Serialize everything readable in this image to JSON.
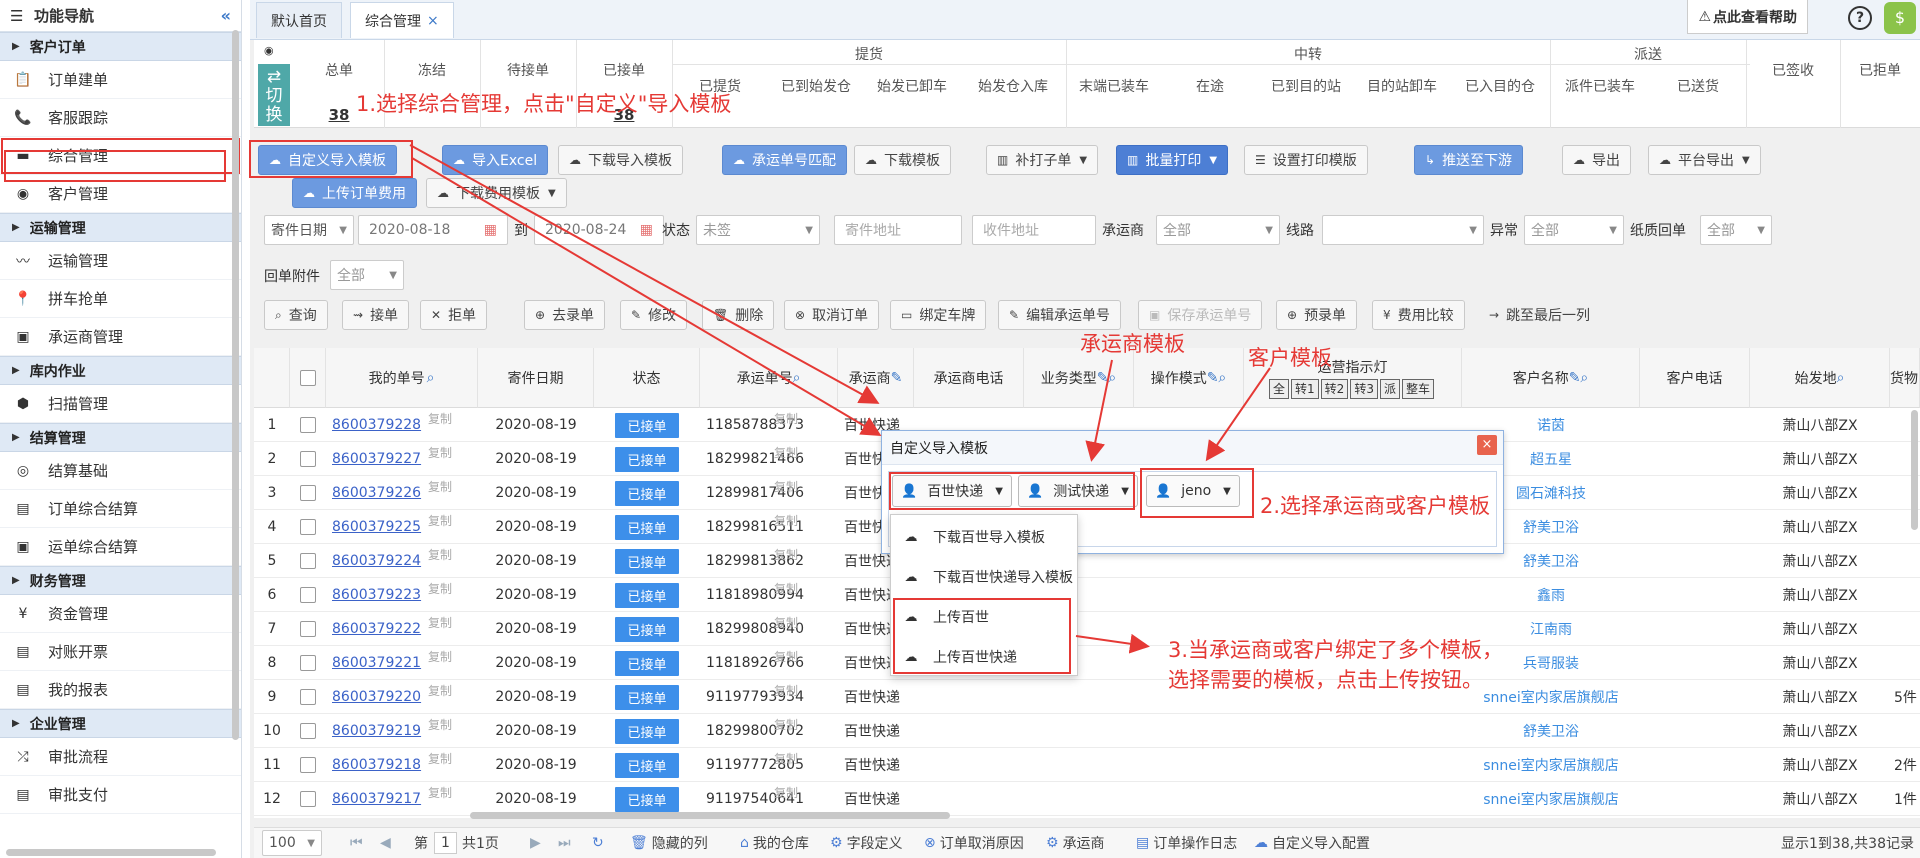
{
  "sidebar": {
    "title": "功能导航",
    "sections": [
      {
        "label": "客户订单",
        "items": [
          "订单建单",
          "客服跟踪",
          "综合管理",
          "客户管理"
        ]
      },
      {
        "label": "运输管理",
        "items": [
          "运输管理",
          "拼车抢单",
          "承运商管理"
        ]
      },
      {
        "label": "库内作业",
        "items": [
          "扫描管理"
        ]
      },
      {
        "label": "结算管理",
        "items": [
          "结算基础",
          "订单综合结算",
          "运单综合结算"
        ]
      },
      {
        "label": "财务管理",
        "items": [
          "资金管理",
          "对账开票",
          "我的报表"
        ]
      },
      {
        "label": "企业管理",
        "items": [
          "审批流程",
          "审批支付"
        ]
      }
    ]
  },
  "tabs": [
    {
      "label": "默认首页"
    },
    {
      "label": "综合管理",
      "close": "×"
    }
  ],
  "help": "点此查看帮助",
  "summary": {
    "switch": "切换",
    "headers": [
      "总单",
      "冻结",
      "待接单",
      "已接单"
    ],
    "group_tihuo": "提货",
    "group_zhongzhuan": "中转",
    "group_paisong": "派送",
    "sub": [
      "已提货",
      "已到始发仓",
      "始发已卸车",
      "始发仓入库",
      "末端已装车",
      "在途",
      "已到目的站",
      "目的站卸车",
      "已入目的仓",
      "派件已装车",
      "已送货"
    ],
    "signed": "已签收",
    "rejected": "已拒单",
    "total_value": "38",
    "accepted_value": "38"
  },
  "toolbar1": [
    "自定义导入模板",
    "导入Excel",
    "下载导入模板",
    "承运单号匹配",
    "下载模板",
    "补打子单",
    "批量打印",
    "设置打印模版",
    "推送至下游",
    "导出",
    "平台导出"
  ],
  "toolbar2": [
    "上传订单费用",
    "下载费用模板"
  ],
  "filters": {
    "date_type": "寄件日期",
    "date_from": "2020-08-18",
    "to": "到",
    "date_to": "2020-08-24",
    "status_label": "状态",
    "status_value": "未签",
    "sender_addr": "寄件地址",
    "recv_addr": "收件地址",
    "carrier_label": "承运商",
    "carrier_value": "全部",
    "route_label": "线路",
    "route_value": "",
    "abnormal_label": "异常",
    "abnormal_value": "全部",
    "paper_label": "纸质回单",
    "paper_value": "全部",
    "attach_label": "回单附件",
    "attach_value": "全部"
  },
  "actions": [
    "查询",
    "接单",
    "拒单",
    "去录单",
    "修改",
    "删除",
    "取消订单",
    "绑定车牌",
    "编辑承运单号",
    "保存承运单号",
    "预录单",
    "费用比较",
    "跳至最后一列"
  ],
  "grid": {
    "headers": [
      "我的单号",
      "寄件日期",
      "状态",
      "承运单号",
      "承运商",
      "承运商电话",
      "业务类型",
      "操作模式",
      "运营指示灯",
      "客户名称",
      "客户电话",
      "始发地",
      "货物"
    ],
    "lights": [
      "全",
      "转1",
      "转2",
      "转3",
      "派",
      "整车"
    ],
    "copy": "复制",
    "rows": [
      [
        "1",
        "8600379228",
        "2020-08-19",
        "已接单",
        "11858788373",
        "百世快递",
        "诺茵",
        "萧山八部ZX",
        ""
      ],
      [
        "2",
        "8600379227",
        "2020-08-19",
        "已接单",
        "18299821466",
        "百世快递",
        "超五星",
        "萧山八部ZX",
        ""
      ],
      [
        "3",
        "8600379226",
        "2020-08-19",
        "已接单",
        "12899817406",
        "百世快递",
        "圆石滩科技",
        "萧山八部ZX",
        ""
      ],
      [
        "4",
        "8600379225",
        "2020-08-19",
        "已接单",
        "18299816511",
        "百世快递",
        "舒美卫浴",
        "萧山八部ZX",
        ""
      ],
      [
        "5",
        "8600379224",
        "2020-08-19",
        "已接单",
        "18299813862",
        "百世快递",
        "舒美卫浴",
        "萧山八部ZX",
        ""
      ],
      [
        "6",
        "8600379223",
        "2020-08-19",
        "已接单",
        "11818980994",
        "百世快递",
        "鑫雨",
        "萧山八部ZX",
        ""
      ],
      [
        "7",
        "8600379222",
        "2020-08-19",
        "已接单",
        "18299808940",
        "百世快递",
        "江南雨",
        "萧山八部ZX",
        ""
      ],
      [
        "8",
        "8600379221",
        "2020-08-19",
        "已接单",
        "11818926766",
        "百世快递",
        "兵哥服装",
        "萧山八部ZX",
        ""
      ],
      [
        "9",
        "8600379220",
        "2020-08-19",
        "已接单",
        "91197793934",
        "百世快递",
        "snnei室内家居旗舰店",
        "萧山八部ZX",
        "5件"
      ],
      [
        "10",
        "8600379219",
        "2020-08-19",
        "已接单",
        "18299800702",
        "百世快递",
        "舒美卫浴",
        "萧山八部ZX",
        ""
      ],
      [
        "11",
        "8600379218",
        "2020-08-19",
        "已接单",
        "91197772805",
        "百世快递",
        "snnei室内家居旗舰店",
        "萧山八部ZX",
        "2件"
      ],
      [
        "12",
        "8600379217",
        "2020-08-19",
        "已接单",
        "91197540641",
        "百世快递",
        "snnei室内家居旗舰店",
        "萧山八部ZX",
        "1件"
      ]
    ]
  },
  "footer": {
    "page_size": "100",
    "page_label": "第",
    "page_no": "1",
    "total_pages": "共1页",
    "links": [
      "隐藏的列",
      "我的仓库",
      "字段定义",
      "订单取消原因",
      "承运商",
      "订单操作日志",
      "自定义导入配置"
    ],
    "summary": "显示1到38,共38记录"
  },
  "dialog": {
    "title": "自定义导入模板",
    "close": "×",
    "dd1": "百世快递",
    "dd2": "测试快递",
    "dd3": "jeno",
    "menu": [
      "下载百世导入模板",
      "下载百世快递导入模板",
      "上传百世",
      "上传百世快递"
    ]
  },
  "annotations": {
    "a1": "1.选择综合管理，点击\"自定义\"导入模板",
    "a_carrier": "承运商模板",
    "a_customer": "客户模板",
    "a2": "2.选择承运商或客户模板",
    "a3_1": "3.当承运商或客户绑定了多个模板，",
    "a3_2": "选择需要的模板，点击上传按钮。"
  },
  "colors": {
    "accent": "#4d7fd5",
    "annotation": "#e53935",
    "status": "#3d8fea"
  }
}
